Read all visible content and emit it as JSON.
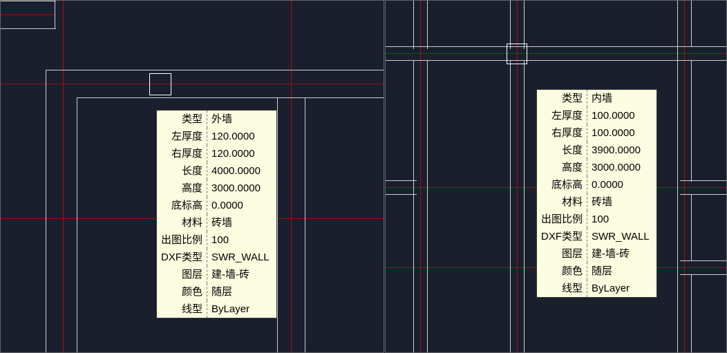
{
  "left_panel": {
    "tooltip": {
      "rows": [
        {
          "label": "类型",
          "value": "外墙"
        },
        {
          "label": "左厚度",
          "value": "120.0000"
        },
        {
          "label": "右厚度",
          "value": "120.0000"
        },
        {
          "label": "长度",
          "value": "4000.0000"
        },
        {
          "label": "高度",
          "value": "3000.0000"
        },
        {
          "label": "底标高",
          "value": "0.0000"
        },
        {
          "label": "材料",
          "value": "砖墙"
        },
        {
          "label": "出图比例",
          "value": "100"
        },
        {
          "label": "DXF类型",
          "value": "SWR_WALL"
        },
        {
          "label": "图层",
          "value": "建-墙-砖"
        },
        {
          "label": "颜色",
          "value": "随层"
        },
        {
          "label": "线型",
          "value": "ByLayer"
        }
      ]
    }
  },
  "right_panel": {
    "tooltip": {
      "rows": [
        {
          "label": "类型",
          "value": "内墙"
        },
        {
          "label": "左厚度",
          "value": "100.0000"
        },
        {
          "label": "右厚度",
          "value": "100.0000"
        },
        {
          "label": "长度",
          "value": "3900.0000"
        },
        {
          "label": "高度",
          "value": "3000.0000"
        },
        {
          "label": "底标高",
          "value": "0.0000"
        },
        {
          "label": "材料",
          "value": "砖墙"
        },
        {
          "label": "出图比例",
          "value": "100"
        },
        {
          "label": "DXF类型",
          "value": "SWR_WALL"
        },
        {
          "label": "图层",
          "value": "建-墙-砖"
        },
        {
          "label": "颜色",
          "value": "随层"
        },
        {
          "label": "线型",
          "value": "ByLayer"
        }
      ]
    }
  }
}
